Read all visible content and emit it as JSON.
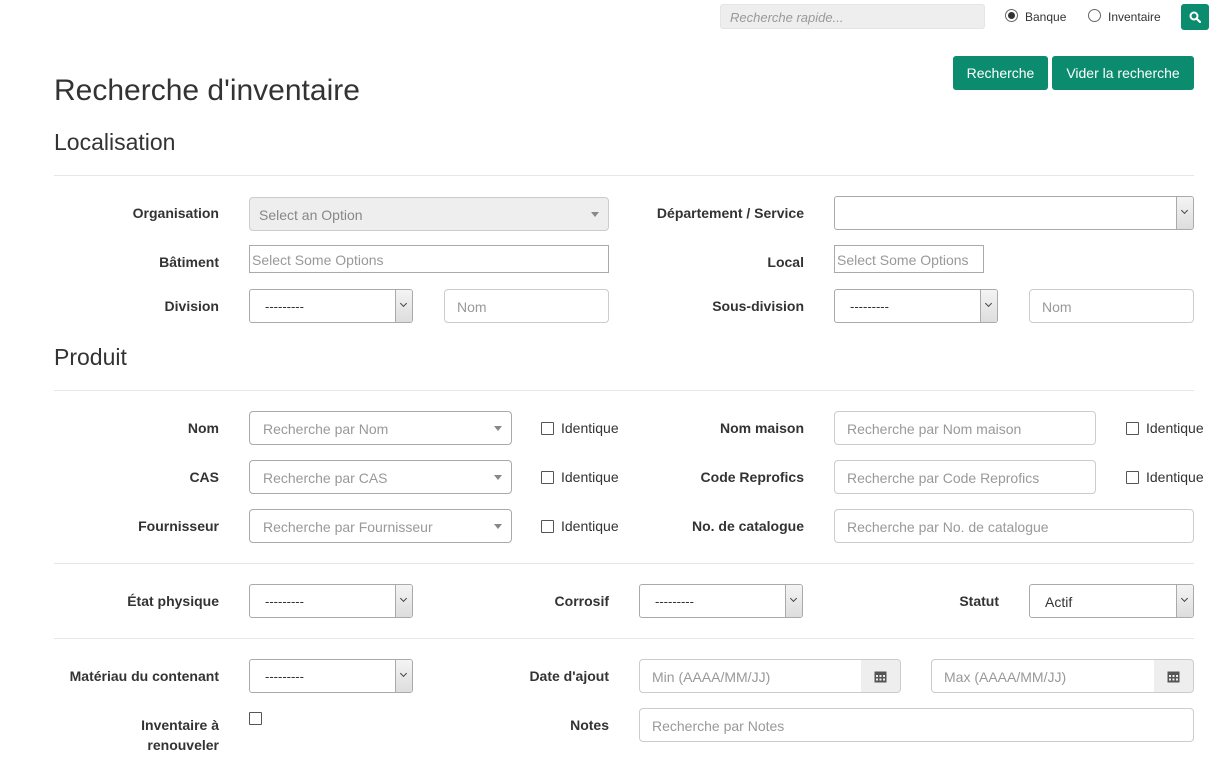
{
  "topbar": {
    "quick_search_placeholder": "Recherche rapide...",
    "radio_banque": "Banque",
    "radio_inventaire": "Inventaire",
    "selected": "Banque"
  },
  "actions": {
    "search": "Recherche",
    "clear": "Vider la recherche"
  },
  "page_title": "Recherche d'inventaire",
  "localisation": {
    "heading": "Localisation",
    "organisation_label": "Organisation",
    "organisation_value": "Select an Option",
    "departement_label": "Département / Service",
    "departement_value": "",
    "batiment_label": "Bâtiment",
    "batiment_placeholder": "Select Some Options",
    "local_label": "Local",
    "local_placeholder": "Select Some Options",
    "division_label": "Division",
    "division_value": "---------",
    "division_name_placeholder": "Nom",
    "sousdivision_label": "Sous-division",
    "sousdivision_value": "---------",
    "sousdivision_name_placeholder": "Nom"
  },
  "produit": {
    "heading": "Produit",
    "identique": "Identique",
    "nom_label": "Nom",
    "nom_placeholder": "Recherche par Nom",
    "nom_maison_label": "Nom maison",
    "nom_maison_placeholder": "Recherche par Nom maison",
    "cas_label": "CAS",
    "cas_placeholder": "Recherche par CAS",
    "code_label": "Code Reprofics",
    "code_placeholder": "Recherche par Code Reprofics",
    "fournisseur_label": "Fournisseur",
    "fournisseur_placeholder": "Recherche par Fournisseur",
    "catalogue_label": "No. de catalogue",
    "catalogue_placeholder": "Recherche par No. de catalogue"
  },
  "etat": {
    "etat_label": "État physique",
    "etat_value": "---------",
    "corrosif_label": "Corrosif",
    "corrosif_value": "---------",
    "statut_label": "Statut",
    "statut_value": "Actif"
  },
  "autres": {
    "materiau_label": "Matériau du contenant",
    "materiau_value": "---------",
    "date_label": "Date d'ajout",
    "date_min_placeholder": "Min (AAAA/MM/JJ)",
    "date_max_placeholder": "Max (AAAA/MM/JJ)",
    "renouveler_label_1": "Inventaire à",
    "renouveler_label_2": "renouveler",
    "notes_label": "Notes",
    "notes_placeholder": "Recherche par Notes"
  },
  "colors": {
    "accent": "#0c8c6e"
  }
}
